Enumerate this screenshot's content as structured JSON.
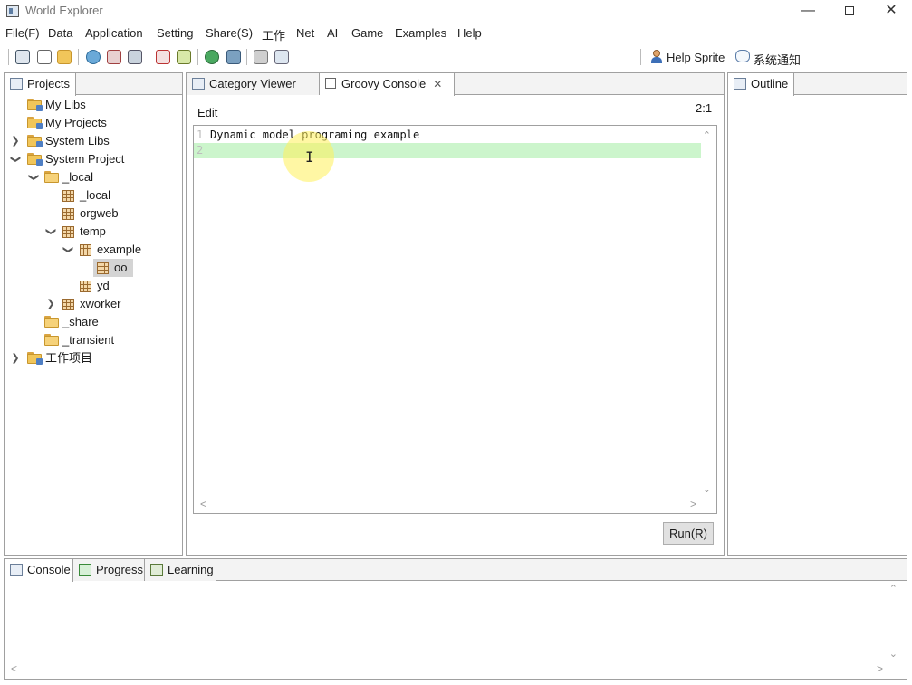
{
  "window": {
    "title": "World Explorer",
    "minimize": "—",
    "close": "✕"
  },
  "menubar": {
    "items": [
      "File(F)",
      "Data",
      "Application",
      "Setting",
      "Share(S)",
      "工作",
      "Net",
      "AI",
      "Game",
      "Examples",
      "Help"
    ]
  },
  "toolbar": {
    "help_sprite": "Help Sprite",
    "system_notice": "系统通知"
  },
  "projects_panel": {
    "tab_label": "Projects",
    "tree": [
      {
        "label": "My Libs",
        "expanded": null
      },
      {
        "label": "My Projects",
        "expanded": null
      },
      {
        "label": "System Libs",
        "expanded": false
      },
      {
        "label": "System Project",
        "expanded": true
      },
      {
        "label": "_local",
        "expanded": true
      },
      {
        "label": "_local",
        "expanded": null
      },
      {
        "label": "orgweb",
        "expanded": null
      },
      {
        "label": "temp",
        "expanded": true
      },
      {
        "label": "example",
        "expanded": true
      },
      {
        "label": "oo",
        "expanded": null,
        "selected": true
      },
      {
        "label": "yd",
        "expanded": null
      },
      {
        "label": "xworker",
        "expanded": false
      },
      {
        "label": "_share",
        "expanded": null
      },
      {
        "label": "_transient",
        "expanded": null
      },
      {
        "label": "工作项目",
        "expanded": false
      }
    ]
  },
  "editor_panel": {
    "tabs": [
      "Category Viewer",
      "Groovy Console"
    ],
    "active_tab": "Groovy Console",
    "edit_label": "Edit",
    "cursor_position": "2:1",
    "lines": [
      {
        "no": "1",
        "text": "Dynamic model programing example"
      },
      {
        "no": "2",
        "text": ""
      }
    ],
    "run_button": "Run(R)"
  },
  "outline_panel": {
    "tab_label": "Outline"
  },
  "bottom_panel": {
    "tabs": [
      "Console",
      "Progress",
      "Learning"
    ],
    "active_tab": "Console"
  },
  "colors": {
    "current_line_highlight": "#ccf5cc",
    "cursor_halo": "#fff05a",
    "selection": "#d4d4d4"
  }
}
